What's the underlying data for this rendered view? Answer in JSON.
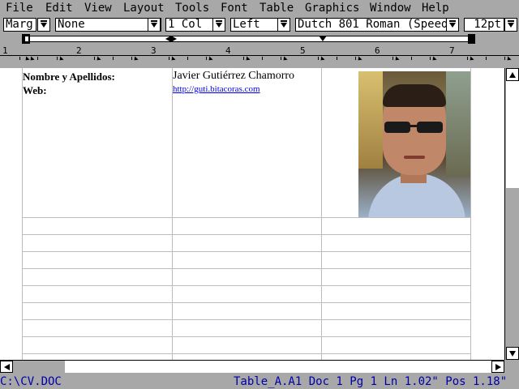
{
  "menu": [
    "File",
    "Edit",
    "View",
    "Layout",
    "Tools",
    "Font",
    "Table",
    "Graphics",
    "Window",
    "Help"
  ],
  "ribbon": {
    "zoom": "Marg",
    "style": "None",
    "columns": "1 Col",
    "justification": "Left",
    "font": "Dutch 801 Roman (Speed",
    "size": "12pt"
  },
  "ruler_numbers": [
    "1",
    "2",
    "3",
    "4",
    "5",
    "6",
    "7"
  ],
  "document": {
    "row1": {
      "label_name": "Nombre y Apellidos:",
      "label_web": "Web:",
      "value_name": "Javier Gutiérrez Chamorro",
      "value_web": "http://guti.bitacoras.com"
    },
    "photo": "portrait-photo"
  },
  "status": {
    "file": "C:\\CV.DOC",
    "position": "Table_A.A1 Doc 1 Pg 1 Ln 1.02\" Pos 1.18\""
  },
  "colors": {
    "background": "#a8a8a8",
    "status_text": "#0000aa",
    "link": "#0000ee"
  }
}
